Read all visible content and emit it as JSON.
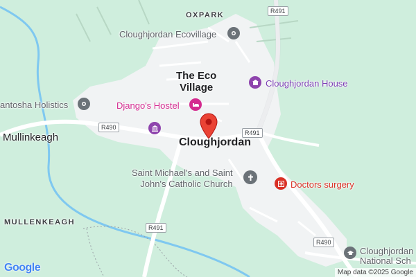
{
  "map": {
    "areas": {
      "oxpark": "OXPARK",
      "mullinkeagh": "Mullinkeagh",
      "mullenkeagh": "MULLENKEAGH"
    },
    "towns": {
      "eco_village_line1": "The Eco",
      "eco_village_line2": "Village",
      "cloughjordan": "Cloughjordan"
    },
    "pois": {
      "ecovillage": "Cloughjordan Ecovillage",
      "house": "Cloughjordan House",
      "hostel": "Django's Hostel",
      "holistics": "antosha Holistics",
      "church_line1": "Saint Michael's and Saint",
      "church_line2": "John's Catholic Church",
      "doctors": "Doctors surgery",
      "school_line1": "Cloughjordan",
      "school_line2": "National Sch"
    },
    "roads": {
      "r491_top": "R491",
      "r490_left": "R490",
      "r491_mid": "R491",
      "r491_bottom": "R491",
      "r490_bottom": "R490"
    },
    "colors": {
      "land": "#cfeedd",
      "town_area": "#f1f3f4",
      "road": "#ffffff",
      "water": "#7fc8f0",
      "marker": "#ea4335",
      "poi_purple": "#8e44ad",
      "poi_pink": "#d42a8f",
      "poi_red": "#d93025",
      "poi_gray": "#6b7278"
    },
    "icons": {
      "marker": "location-pin-icon",
      "ecovillage": "place-icon",
      "house": "landmark-icon",
      "hostel": "bed-icon",
      "holistics": "place-icon",
      "church": "cross-icon",
      "doctors": "medical-icon",
      "school": "school-icon",
      "museum": "museum-icon"
    }
  },
  "attribution": {
    "logo": "Google",
    "text": "Map data ©2025 Google"
  }
}
